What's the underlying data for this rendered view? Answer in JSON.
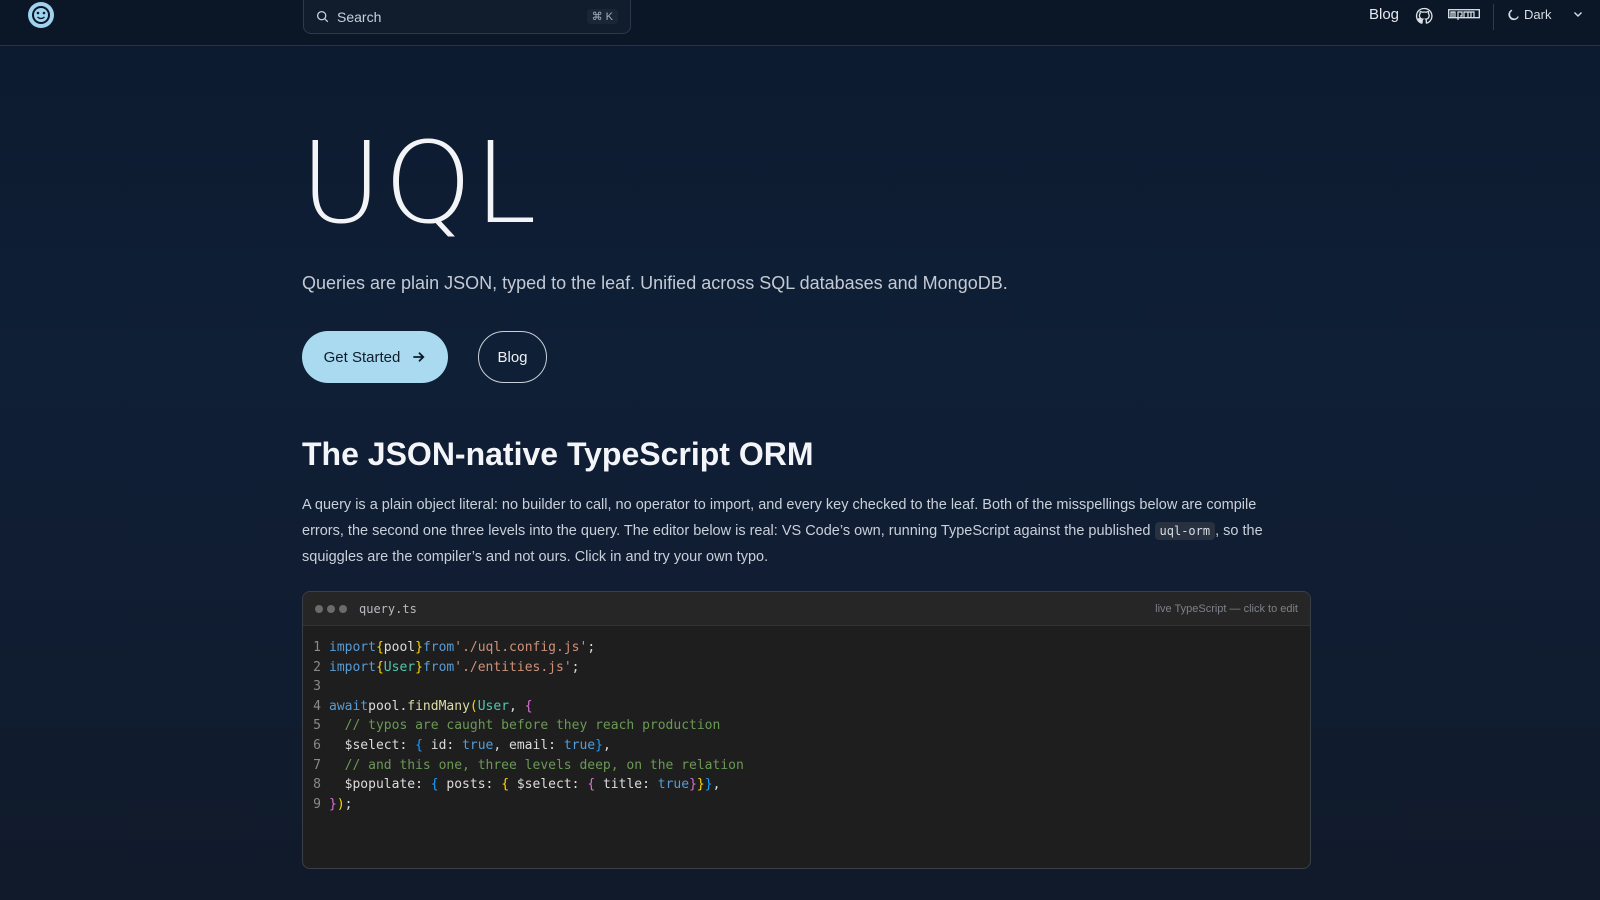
{
  "header": {
    "search_label": "Search",
    "search_shortcut": "⌘ K",
    "blog_link": "Blog",
    "theme_label": "Dark",
    "icons": [
      "logo-icon",
      "search-icon",
      "github-icon",
      "npm-icon",
      "moon-icon",
      "chevron-down-icon"
    ]
  },
  "hero": {
    "title": "UQL",
    "subtitle": "Queries are plain JSON, typed to the leaf. Unified across SQL databases and MongoDB.",
    "primary_button": "Get Started",
    "secondary_button": "Blog"
  },
  "section": {
    "title": "The JSON-native TypeScript ORM",
    "para_part1": "A query is a plain object literal: no builder to call, no operator to import, and every key checked to the leaf. Both of the misspellings below are compile errors, the second one three levels into the query. The editor below is real: VS Code’s own, running TypeScript against the published ",
    "para_code": "uql-orm",
    "para_part2": ", so the squiggles are the compiler’s and not ours. Click in and try your own typo."
  },
  "editor": {
    "filename": "query.ts",
    "hint": "live TypeScript — click to edit",
    "line_numbers": [
      "1",
      "2",
      "3",
      "4",
      "5",
      "6",
      "7",
      "8",
      "9"
    ]
  },
  "colors": {
    "background": "#0f1f36",
    "accent_button": "#a9daf0",
    "editor_bg": "#1e1e1e"
  }
}
